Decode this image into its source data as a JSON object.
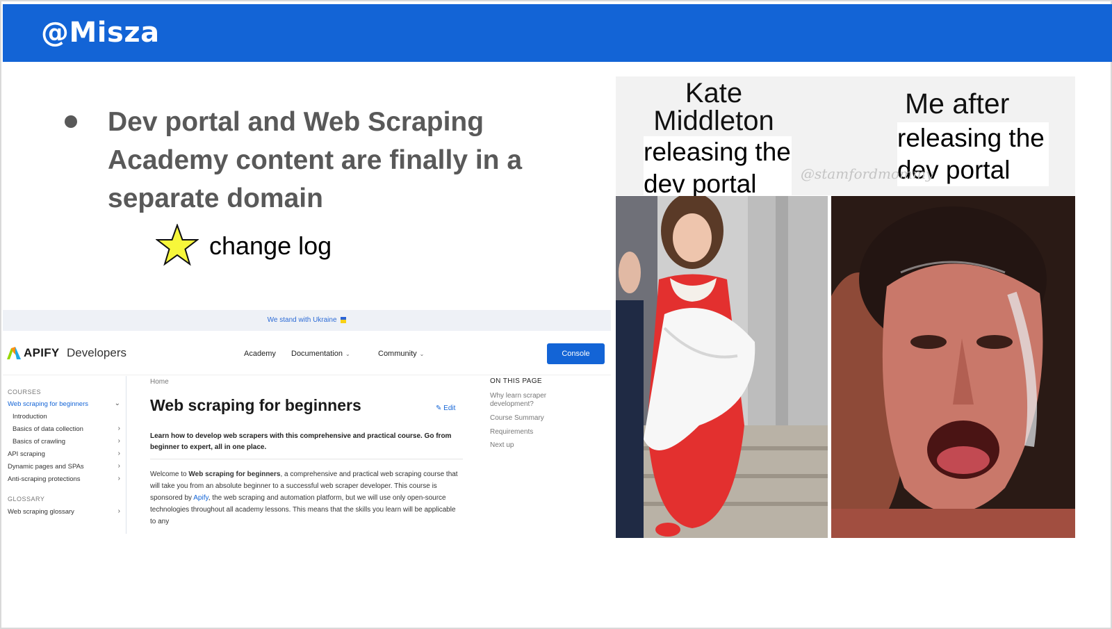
{
  "header": {
    "title": "@Misza"
  },
  "main": {
    "bullet": "Dev portal and Web Scraping Academy content  are finally in a separate domain",
    "star_icon": "star-icon",
    "changelog": "change log"
  },
  "site": {
    "banner": "We stand with Ukraine",
    "logo_brand": "APIFY",
    "logo_suffix": "Developers",
    "nav": {
      "academy": "Academy",
      "documentation": "Documentation",
      "community": "Community"
    },
    "console_button": "Console",
    "sidebar": {
      "courses_heading": "COURSES",
      "items": [
        "Web scraping for beginners",
        "Introduction",
        "Basics of data collection",
        "Basics of crawling",
        "API scraping",
        "Dynamic pages and SPAs",
        "Anti-scraping protections"
      ],
      "glossary_heading": "GLOSSARY",
      "glossary_item": "Web scraping glossary"
    },
    "breadcrumb": "Home",
    "page_title": "Web scraping for beginners",
    "edit_label": "Edit",
    "lead": "Learn how to develop web scrapers with this comprehensive and practical course. Go from beginner to expert, all in one place.",
    "body": {
      "p1": "Welcome to ",
      "bold": "Web scraping for beginners",
      "p2": ", a comprehensive and practical web scraping course that will take you from an absolute beginner to a successful web scraper developer. This course is sponsored by ",
      "link": "Apify",
      "p3": ", the web scraping and automation platform, but we will use only open-source technologies throughout all academy lessons. This means that the skills you learn will be applicable to any"
    },
    "toc": {
      "heading": "ON THIS PAGE",
      "items": [
        "Why learn scraper development?",
        "Course Summary",
        "Requirements",
        "Next up"
      ]
    }
  },
  "meme": {
    "kate_caption": "Kate Middleton",
    "left_caption": "releasing the dev portal",
    "me_caption": "Me after",
    "right_caption": "releasing the dev portal",
    "watermark": "@stamfordmommy"
  },
  "colors": {
    "header_blue": "#1364d6",
    "bullet_grey": "#595959",
    "star_yellow": "#f7f73a",
    "dress_red": "#e3302f"
  }
}
